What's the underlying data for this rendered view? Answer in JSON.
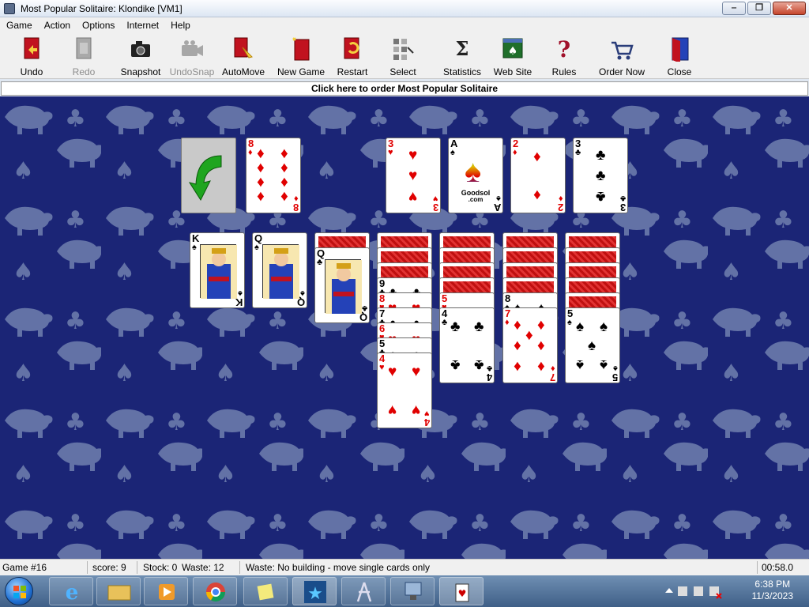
{
  "window": {
    "title": "Most Popular Solitaire: Klondike [VM1]",
    "buttons": {
      "minimize": "‒",
      "maximize": "❐",
      "close": "✕"
    }
  },
  "menu": [
    "Game",
    "Action",
    "Options",
    "Internet",
    "Help"
  ],
  "toolbar": [
    {
      "label": "Undo",
      "icon": "undo-icon",
      "enabled": true
    },
    {
      "label": "Redo",
      "icon": "redo-icon",
      "enabled": false
    },
    {
      "label": "Snapshot",
      "icon": "camera-icon",
      "enabled": true
    },
    {
      "label": "UndoSnap",
      "icon": "video-camera-icon",
      "enabled": false
    },
    {
      "label": "AutoMove",
      "icon": "automove-icon",
      "enabled": true
    },
    {
      "label": "New Game",
      "icon": "new-game-icon",
      "enabled": true
    },
    {
      "label": "Restart",
      "icon": "restart-icon",
      "enabled": true
    },
    {
      "label": "Select",
      "icon": "select-icon",
      "enabled": true
    },
    {
      "label": "Statistics",
      "icon": "sigma-icon",
      "enabled": true
    },
    {
      "label": "Web Site",
      "icon": "web-site-icon",
      "enabled": true
    },
    {
      "label": "Rules",
      "icon": "question-icon",
      "enabled": true
    },
    {
      "label": "Order Now",
      "icon": "cart-icon",
      "enabled": true
    },
    {
      "label": "Close",
      "icon": "door-icon",
      "enabled": true
    }
  ],
  "banner": "Click here to order Most Popular Solitaire",
  "game": {
    "waste": {
      "rank": "8",
      "suit": "♦",
      "color": "red"
    },
    "foundations": [
      {
        "rank": "3",
        "suit": "♥",
        "color": "red"
      },
      {
        "rank": "A",
        "suit": "♠",
        "color": "black",
        "logo_line1": "Goodsol",
        "logo_line2": ".com"
      },
      {
        "rank": "2",
        "suit": "♦",
        "color": "red"
      },
      {
        "rank": "3",
        "suit": "♣",
        "color": "black"
      }
    ],
    "tableau": [
      {
        "backs": 0,
        "cards": [
          {
            "rank": "K",
            "suit": "♠",
            "color": "black"
          }
        ]
      },
      {
        "backs": 0,
        "cards": [
          {
            "rank": "Q",
            "suit": "♠",
            "color": "black"
          }
        ]
      },
      {
        "backs": 1,
        "cards": [
          {
            "rank": "Q",
            "suit": "♣",
            "color": "black"
          }
        ]
      },
      {
        "backs": 3,
        "cards": [
          {
            "rank": "9",
            "suit": "♣",
            "color": "black"
          },
          {
            "rank": "8",
            "suit": "♥",
            "color": "red"
          },
          {
            "rank": "7",
            "suit": "♣",
            "color": "black"
          },
          {
            "rank": "6",
            "suit": "♥",
            "color": "red"
          },
          {
            "rank": "5",
            "suit": "♣",
            "color": "black"
          },
          {
            "rank": "4",
            "suit": "♥",
            "color": "red"
          }
        ]
      },
      {
        "backs": 4,
        "cards": [
          {
            "rank": "5",
            "suit": "♥",
            "color": "red"
          },
          {
            "rank": "4",
            "suit": "♣",
            "color": "black"
          }
        ]
      },
      {
        "backs": 4,
        "cards": [
          {
            "rank": "8",
            "suit": "♠",
            "color": "black"
          },
          {
            "rank": "7",
            "suit": "♦",
            "color": "red"
          }
        ]
      },
      {
        "backs": 5,
        "cards": [
          {
            "rank": "5",
            "suit": "♠",
            "color": "black"
          }
        ]
      }
    ]
  },
  "status": {
    "game": "Game #16",
    "score": "score: 9",
    "stock": "Stock: 0",
    "waste": "Waste: 12",
    "message": "Waste: No building - move single cards only",
    "timer": "00:58.0"
  },
  "taskbar": {
    "time": "6:38 PM",
    "date": "11/3/2023",
    "items": [
      "explorer",
      "internet-explorer",
      "windows-explorer",
      "media-player",
      "chrome",
      "sticky-notes",
      "star-app",
      "tool-app",
      "network-app",
      "solitaire"
    ]
  },
  "colors": {
    "felt": "#1b2576",
    "felt_pattern": "#6f7fae",
    "red_suit": "#e00000"
  }
}
